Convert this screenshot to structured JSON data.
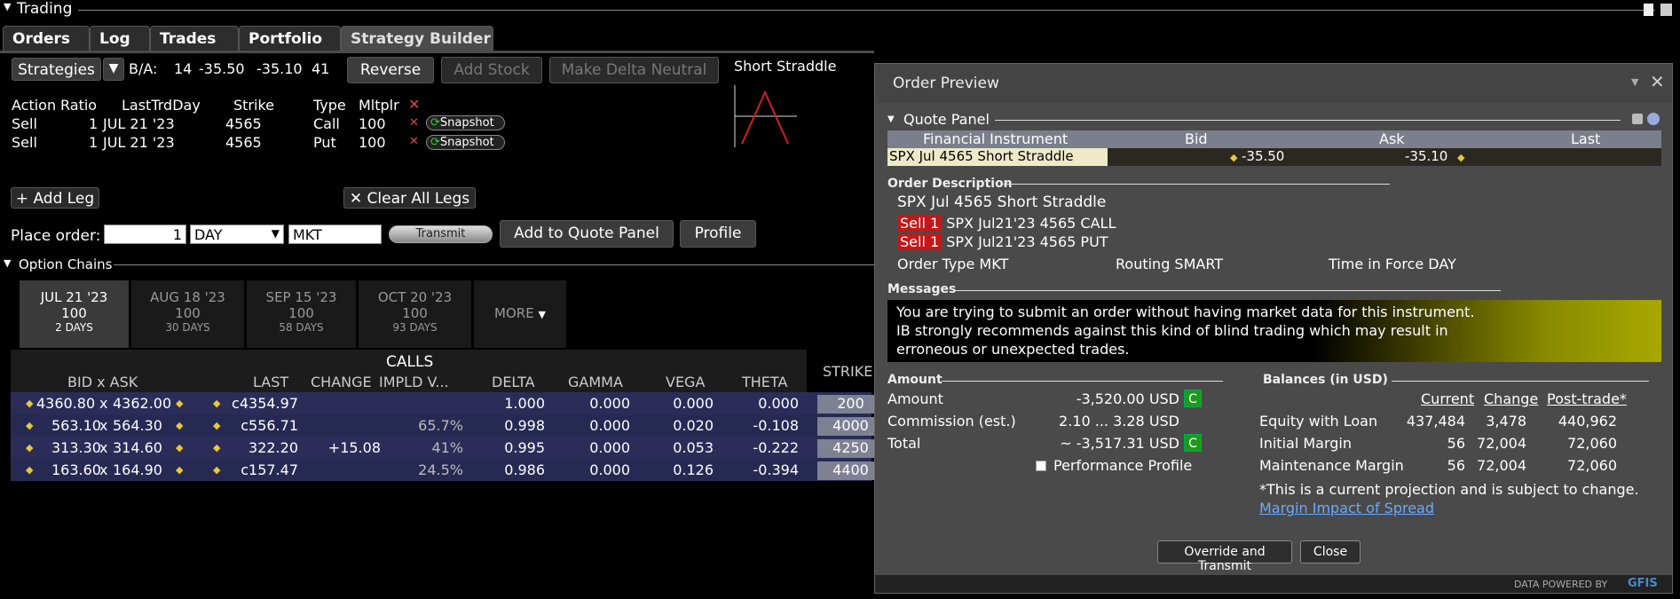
{
  "app": {
    "title": "Trading"
  },
  "tabs": [
    "Orders",
    "Log",
    "Trades",
    "Portfolio",
    "Strategy Builder"
  ],
  "toolbar": {
    "strategies_label": "Strategies",
    "ba_label": "B/A:",
    "ba_bid_size": "14",
    "ba_bid": "-35.50",
    "ba_ask": "-35.10",
    "ba_ask_size": "41",
    "reverse_label": "Reverse",
    "add_stock_label": "Add Stock",
    "delta_neutral_label": "Make Delta Neutral"
  },
  "strategy_name": "Short Straddle",
  "legs": {
    "headers": [
      "Action",
      "Ratio",
      "LastTrdDay",
      "Strike",
      "Type",
      "Mltplr"
    ],
    "rows": [
      {
        "action": "Sell",
        "ratio": "1",
        "last": "JUL 21 '23",
        "strike": "4565",
        "type": "Call",
        "mult": "100",
        "snap": "Snapshot"
      },
      {
        "action": "Sell",
        "ratio": "1",
        "last": "JUL 21 '23",
        "strike": "4565",
        "type": "Put",
        "mult": "100",
        "snap": "Snapshot"
      }
    ],
    "add_leg_label": "+ Add Leg",
    "clear_legs_label": "Clear All Legs"
  },
  "place_order": {
    "label": "Place order:",
    "qty": "1",
    "tif": "DAY",
    "type": "MKT",
    "transmit_label": "Transmit",
    "add_quote_label": "Add to Quote Panel",
    "profile_label": "Profile"
  },
  "option_chains": {
    "title": "Option Chains",
    "expiries": [
      {
        "date": "JUL 21 '23",
        "mult": "100",
        "days": "2 DAYS"
      },
      {
        "date": "AUG 18 '23",
        "mult": "100",
        "days": "30 DAYS"
      },
      {
        "date": "SEP 15 '23",
        "mult": "100",
        "days": "58 DAYS"
      },
      {
        "date": "OCT 20 '23",
        "mult": "100",
        "days": "93 DAYS"
      }
    ],
    "more_label": "MORE",
    "calls_label": "CALLS",
    "headers": {
      "bidask": "BID x  ASK",
      "last": "LAST",
      "change": "CHANGE",
      "iv": "IMPLD V...",
      "delta": "DELTA",
      "gamma": "GAMMA",
      "vega": "VEGA",
      "theta": "THETA",
      "strike": "STRIKE"
    },
    "rows": [
      {
        "bid": "4360.80",
        "ask": "4362.00",
        "last": "c4354.97",
        "change": "",
        "iv": "",
        "delta": "1.000",
        "gamma": "0.000",
        "vega": "0.000",
        "theta": "0.000",
        "strike": "200"
      },
      {
        "bid": "563.10",
        "ask": "564.30",
        "last": "c556.71",
        "change": "",
        "iv": "65.7%",
        "delta": "0.998",
        "gamma": "0.000",
        "vega": "0.020",
        "theta": "-0.108",
        "strike": "4000"
      },
      {
        "bid": "313.30",
        "ask": "314.60",
        "last": "322.20",
        "change": "+15.08",
        "iv": "41%",
        "delta": "0.995",
        "gamma": "0.000",
        "vega": "0.053",
        "theta": "-0.222",
        "strike": "4250"
      },
      {
        "bid": "163.60",
        "ask": "164.90",
        "last": "c157.47",
        "change": "",
        "iv": "24.5%",
        "delta": "0.986",
        "gamma": "0.000",
        "vega": "0.126",
        "theta": "-0.394",
        "strike": "4400"
      }
    ]
  },
  "order_preview": {
    "title": "Order Preview",
    "quote_panel": {
      "title": "Quote Panel",
      "headers": [
        "Financial Instrument",
        "Bid",
        "Ask",
        "Last"
      ],
      "instrument": "SPX Jul 4565 Short Straddle",
      "bid": "-35.50",
      "ask": "-35.10",
      "last": ""
    },
    "order_description": {
      "title": "Order Description",
      "name": "SPX Jul 4565 Short Straddle",
      "legs": [
        {
          "badge": "Sell 1",
          "text": "SPX Jul21'23 4565 CALL"
        },
        {
          "badge": "Sell 1",
          "text": "SPX Jul21'23 4565 PUT"
        }
      ],
      "order_type": "Order Type MKT",
      "routing": "Routing SMART",
      "tif": "Time in Force DAY"
    },
    "messages": {
      "title": "Messages",
      "lines": [
        "You are trying to submit an order without having market data for this instrument.",
        "IB strongly recommends against this kind of blind trading which may result in",
        "erroneous or unexpected trades."
      ]
    },
    "amount": {
      "title": "Amount",
      "rows": [
        {
          "label": "Amount",
          "value": "-3,520.00 USD",
          "badge": "C"
        },
        {
          "label": "Commission (est.)",
          "value": "2.10 ... 3.28 USD",
          "badge": ""
        },
        {
          "label": "Total",
          "value": "~ -3,517.31 USD",
          "badge": "C"
        }
      ],
      "perf_profile": "Performance Profile"
    },
    "balances": {
      "title": "Balances (in USD)",
      "headers": [
        "Current",
        "Change",
        "Post-trade*"
      ],
      "rows": [
        {
          "label": "Equity with Loan",
          "current": "437,484",
          "change": "3,478",
          "post": "440,962"
        },
        {
          "label": "Initial Margin",
          "current": "56",
          "change": "72,004",
          "post": "72,060"
        },
        {
          "label": "Maintenance Margin",
          "current": "56",
          "change": "72,004",
          "post": "72,060"
        }
      ],
      "note": "*This is a current projection and is subject to change.",
      "link": "Margin Impact of Spread"
    },
    "override_label": "Override and Transmit",
    "close_label": "Close",
    "footer": "DATA POWERED BY",
    "footer_brand": "GFIS"
  }
}
